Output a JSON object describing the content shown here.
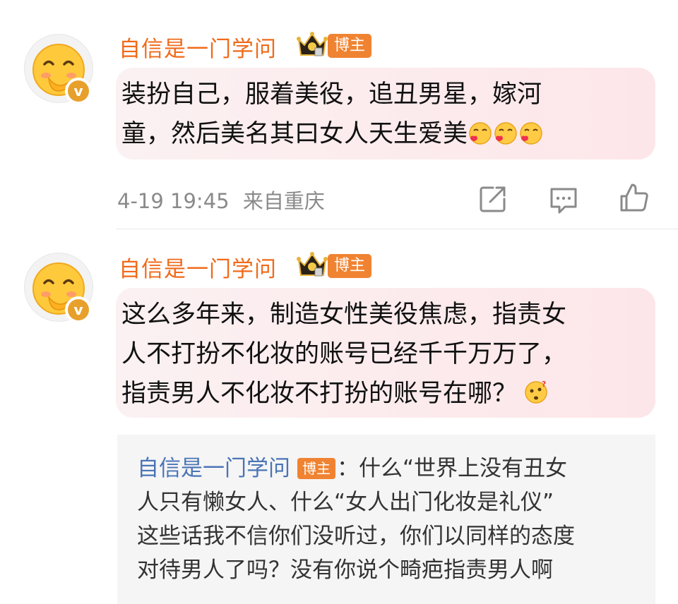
{
  "comments": [
    {
      "username": "自信是一门学问",
      "badge": "博主",
      "lines": [
        "装扮自己，服着美役，追丑男星，嫁河",
        "童，然后美名其曰女人天生爱美"
      ],
      "time": "4-19 19:45",
      "location": "来自重庆"
    },
    {
      "username": "自信是一门学问",
      "badge": "博主",
      "lines": [
        "这么多年来，制造女性美役焦虑，指责女",
        "人不打扮不化妆的账号已经千千万万了，",
        "指责男人不化妆不打扮的账号在哪？"
      ]
    }
  ],
  "reply": {
    "username": "自信是一门学问",
    "badge": "博主",
    "separator": "：",
    "lines": [
      "什么“世界上没有丑女",
      "人只有懒女人、什么“女人出门化妆是礼仪”",
      "这些话我不信你们没听过，你们以同样的态度",
      "对待男人了吗？没有你说个畸疤指责男人啊"
    ]
  },
  "colors": {
    "username": "#f06a1a",
    "badge": "#f08331",
    "reply_name": "#4a74b6",
    "bubble": "#fde6e9"
  },
  "icons": [
    "share-icon",
    "comment-icon",
    "like-icon",
    "crown-icon",
    "verified-v-icon",
    "emoji-love-icon",
    "emoji-thinking-icon"
  ]
}
